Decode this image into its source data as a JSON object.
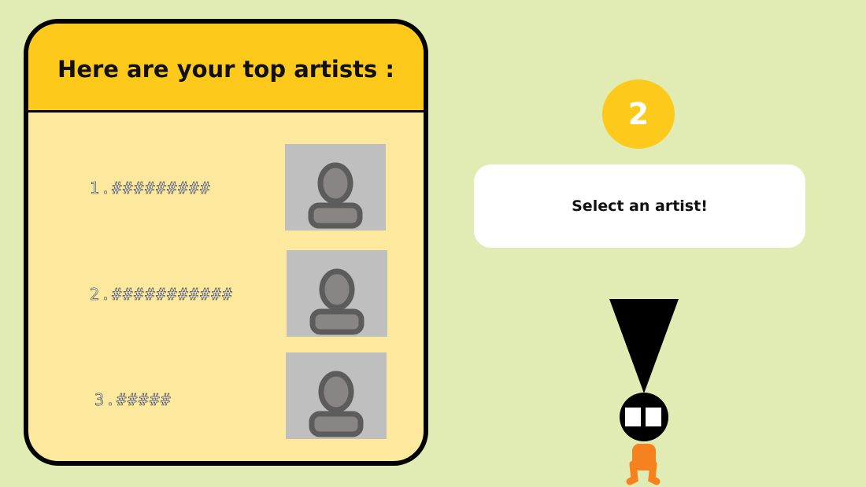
{
  "panel": {
    "title": "Here are your top artists :",
    "artists": [
      {
        "label": "1.#########",
        "photo_icon": "user-silhouette-icon"
      },
      {
        "label": "2.###########",
        "photo_icon": "user-silhouette-icon"
      },
      {
        "label": "3.#####",
        "photo_icon": "user-silhouette-icon"
      }
    ]
  },
  "step": {
    "number": "2"
  },
  "prompt": {
    "text": "Select an artist!"
  },
  "colors": {
    "background": "#e0ecb4",
    "header": "#fdca1c",
    "panel_body": "#fde99e",
    "badge": "#fdca1c",
    "photo_bg": "#bfbfbf",
    "character_body": "#f5821f"
  }
}
